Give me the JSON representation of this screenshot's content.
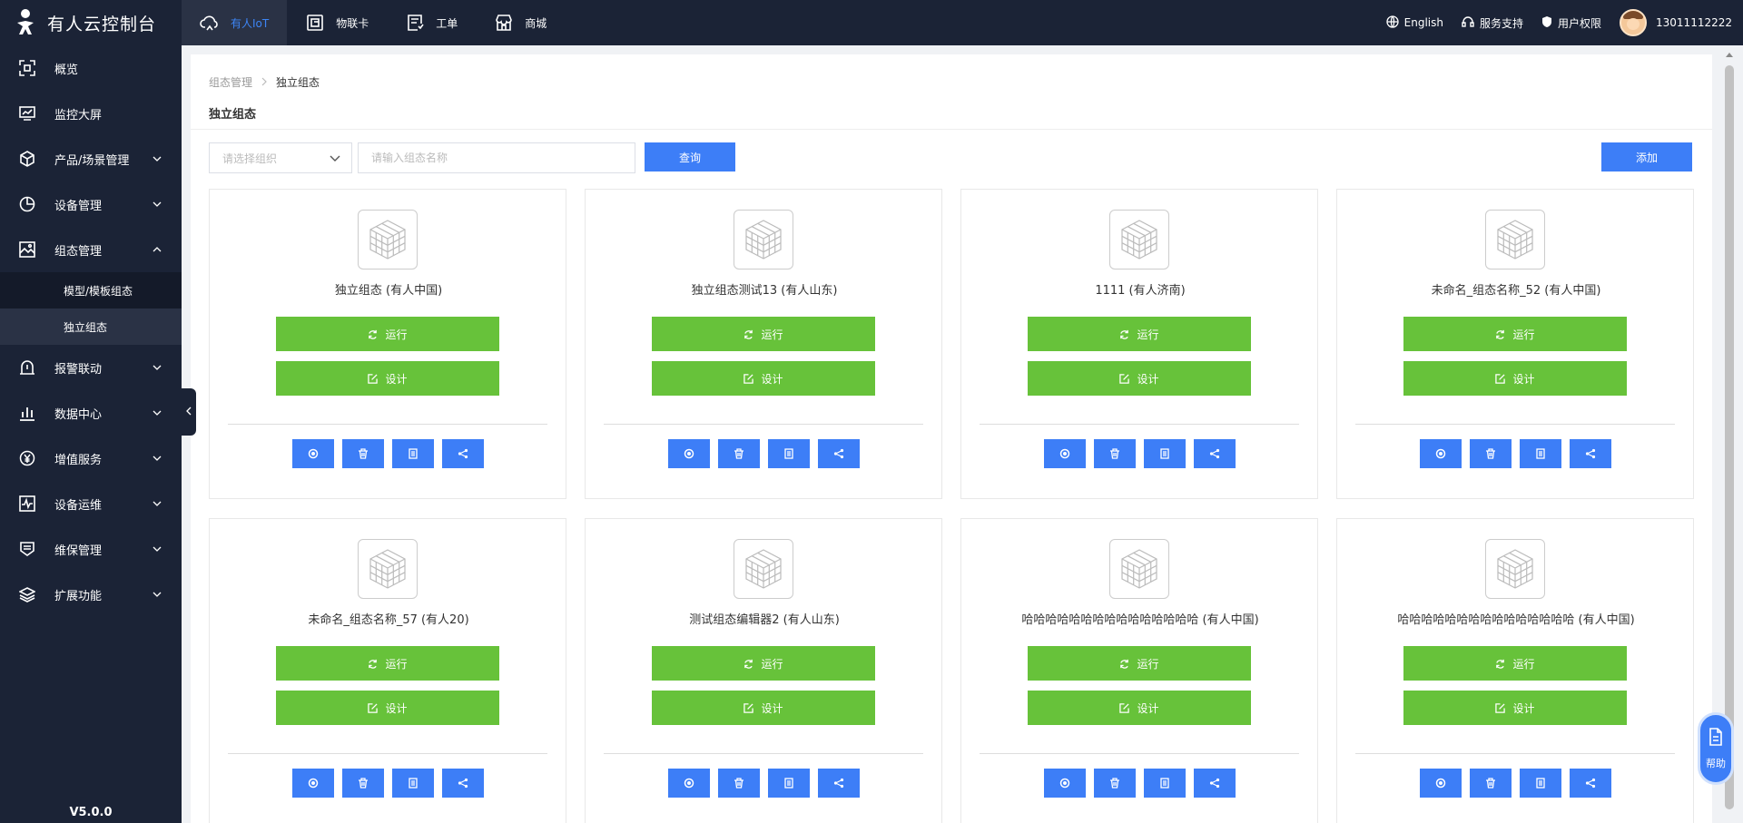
{
  "sidebar": {
    "logo_text": "有人云控制台",
    "items": [
      {
        "label": "概览",
        "icon": "overview-icon",
        "has_chevron": false
      },
      {
        "label": "监控大屏",
        "icon": "monitor-icon",
        "has_chevron": false
      },
      {
        "label": "产品/场景管理",
        "icon": "cube-icon",
        "has_chevron": true
      },
      {
        "label": "设备管理",
        "icon": "pie-icon",
        "has_chevron": true
      },
      {
        "label": "组态管理",
        "icon": "image-icon",
        "has_chevron": true,
        "expanded": true
      },
      {
        "label": "报警联动",
        "icon": "alarm-icon",
        "has_chevron": true
      },
      {
        "label": "数据中心",
        "icon": "bar-chart-icon",
        "has_chevron": true
      },
      {
        "label": "增值服务",
        "icon": "yen-icon",
        "has_chevron": true
      },
      {
        "label": "设备运维",
        "icon": "pulse-icon",
        "has_chevron": true
      },
      {
        "label": "维保管理",
        "icon": "maintenance-icon",
        "has_chevron": true
      },
      {
        "label": "扩展功能",
        "icon": "layers-icon",
        "has_chevron": true
      }
    ],
    "submenu": [
      {
        "label": "模型/模板组态",
        "active": false
      },
      {
        "label": "独立组态",
        "active": true
      }
    ],
    "version": "V5.0.0"
  },
  "topbar": {
    "tabs": [
      {
        "label": "有人IoT",
        "icon": "cloud-icon",
        "active": true
      },
      {
        "label": "物联卡",
        "icon": "sim-card-icon",
        "active": false
      },
      {
        "label": "工单",
        "icon": "work-order-icon",
        "active": false
      },
      {
        "label": "商城",
        "icon": "store-icon",
        "active": false
      }
    ],
    "language": "English",
    "support": "服务支持",
    "permission": "用户权限",
    "username": "13011112222"
  },
  "main": {
    "breadcrumb": {
      "parent": "组态管理",
      "current": "独立组态"
    },
    "title": "独立组态",
    "filter": {
      "select_placeholder": "请选择组织",
      "name_placeholder": "请输入组态名称",
      "query_label": "查询",
      "add_label": "添加"
    },
    "run_label": "运行",
    "design_label": "设计",
    "cards": [
      {
        "name": "独立组态 (有人中国)"
      },
      {
        "name": "独立组态测试13 (有人山东)"
      },
      {
        "name": "1111 (有人济南)"
      },
      {
        "name": "未命名_组态名称_52 (有人中国)"
      },
      {
        "name": "未命名_组态名称_57 (有人20)"
      },
      {
        "name": "测试组态编辑器2 (有人山东)"
      },
      {
        "name": "哈哈哈哈哈哈哈哈哈哈哈哈哈哈哈 (有人中国)"
      },
      {
        "name": "哈哈哈哈哈哈哈哈哈哈哈哈哈哈哈 (有人中国)"
      }
    ]
  },
  "help": {
    "label": "帮助"
  },
  "colors": {
    "sidebar_bg": "#1b2336",
    "primary": "#3d7ef7",
    "success": "#67c23a"
  }
}
